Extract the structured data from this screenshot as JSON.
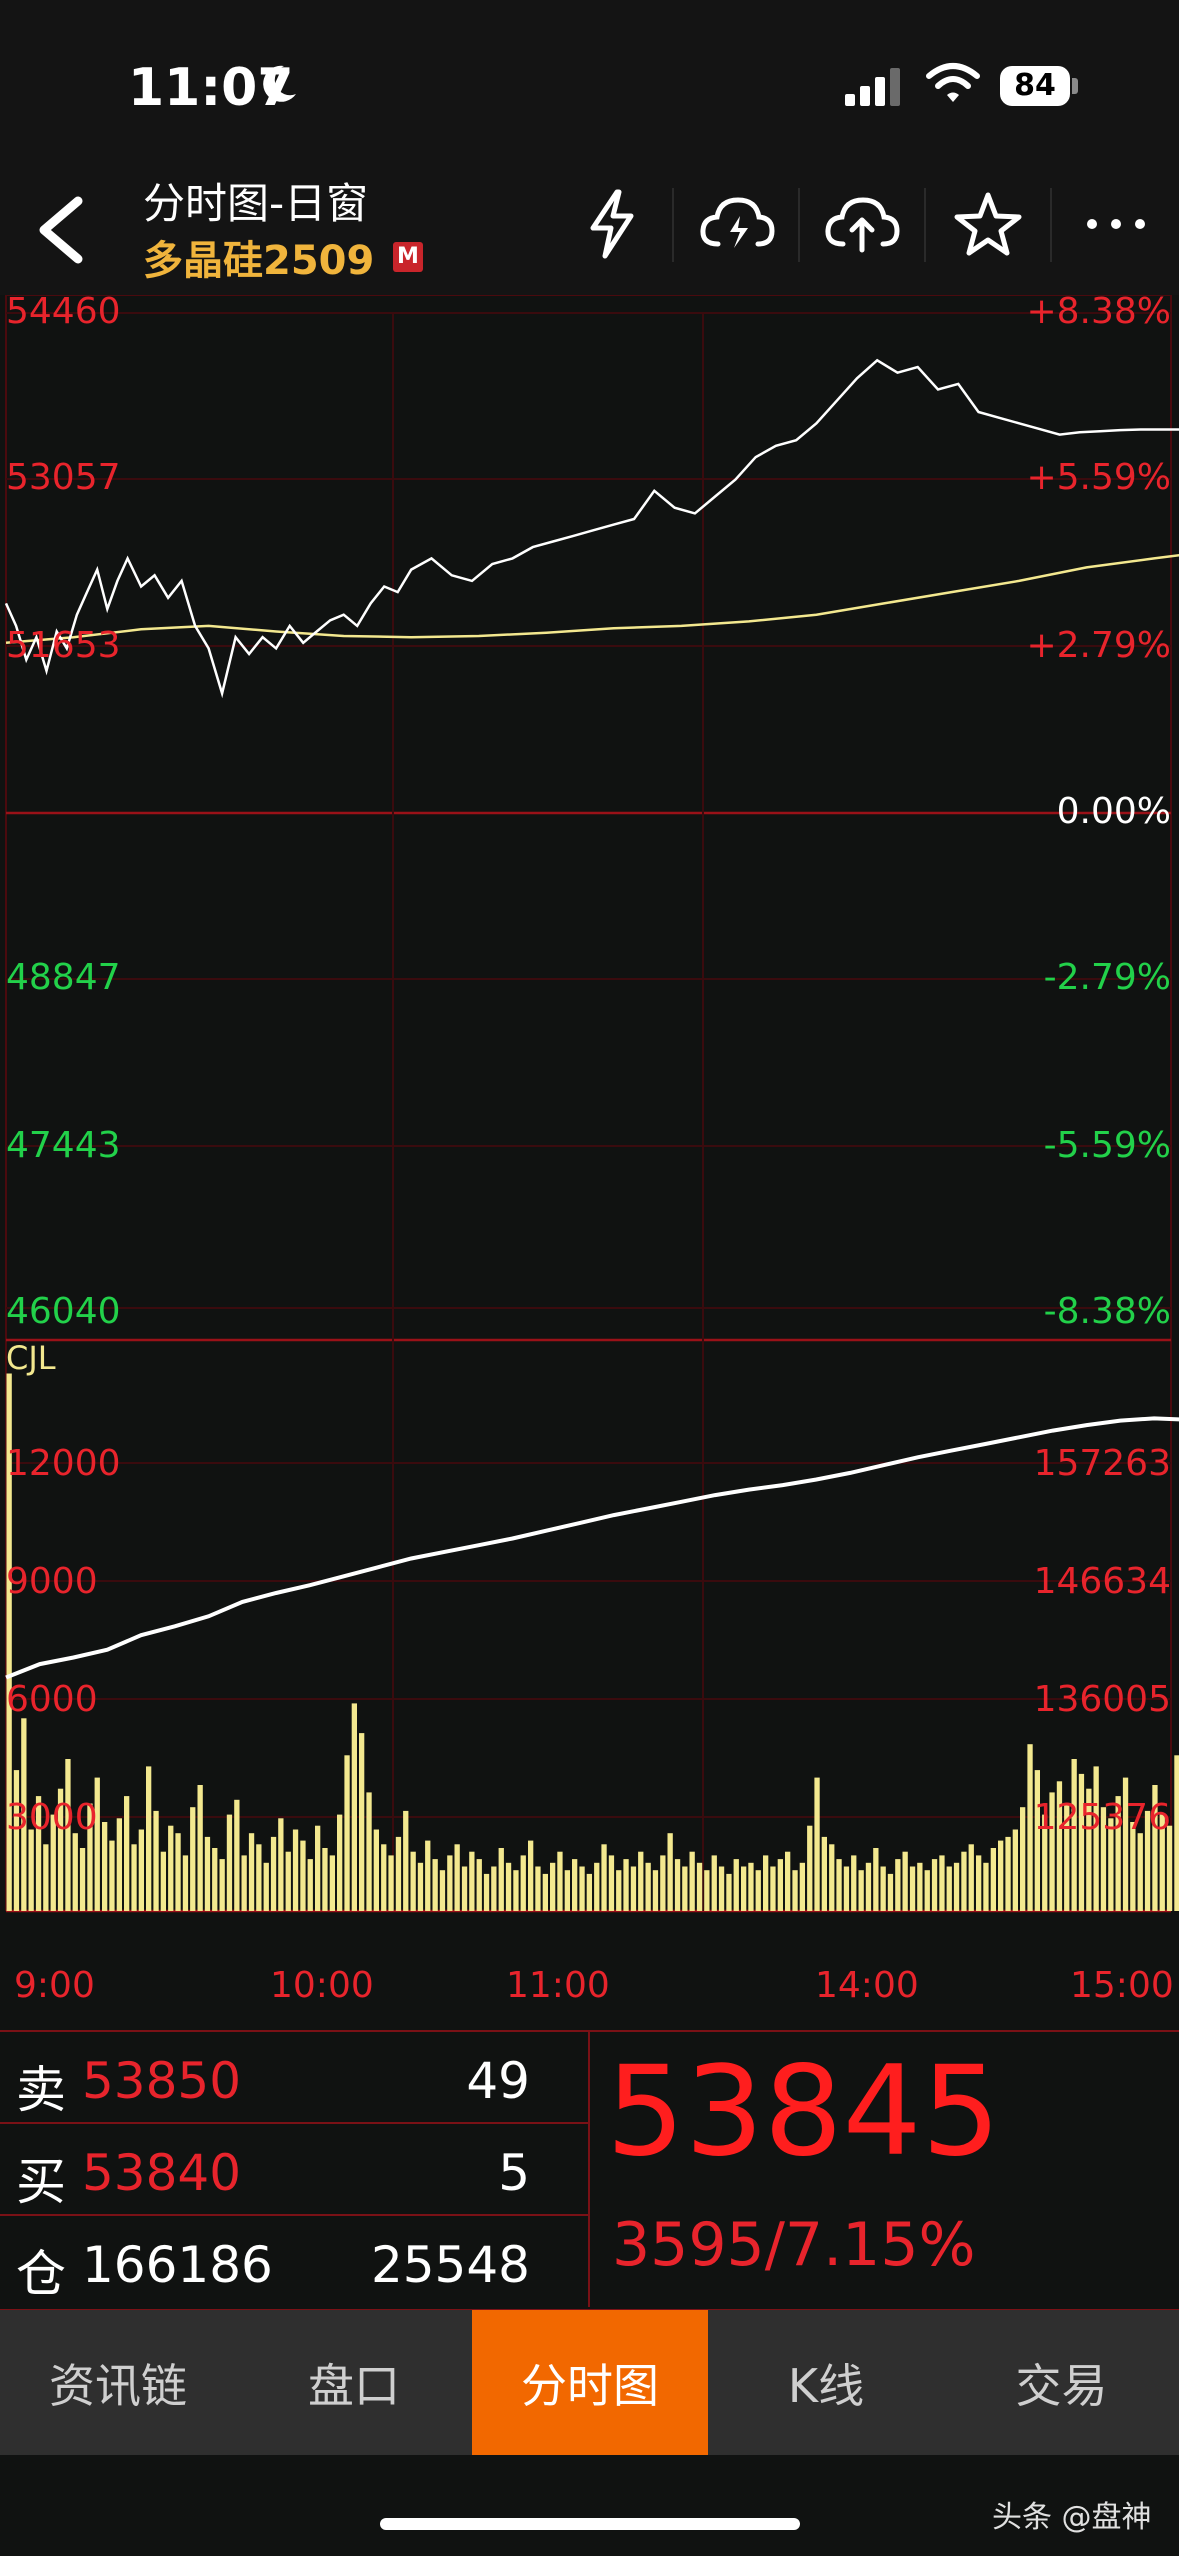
{
  "status_bar": {
    "time": "11:07",
    "battery": "84"
  },
  "header": {
    "title": "分时图-日窗",
    "instrument": "多晶硅2509",
    "badge": "M",
    "tools": [
      "lightning-icon",
      "cloud-lightning-icon",
      "cloud-upload-icon",
      "star-icon",
      "more-icon"
    ]
  },
  "chart": {
    "price_labels_left": [
      "54460",
      "53057",
      "51653",
      "48847",
      "47443",
      "46040"
    ],
    "pct_labels_right": [
      "+8.38%",
      "+5.59%",
      "+2.79%",
      "0.00%",
      "-2.79%",
      "-5.59%",
      "-8.38%"
    ],
    "indicator_name": "CJL",
    "vol_labels_left": [
      "12000",
      "9000",
      "6000",
      "3000"
    ],
    "oi_labels_right": [
      "157263",
      "146634",
      "136005",
      "125376"
    ],
    "time_labels": [
      "9:00",
      "10:00",
      "11:00",
      "14:00",
      "15:00"
    ]
  },
  "chart_data": {
    "type": "line",
    "x_session_minutes": 345,
    "price_line": {
      "t": [
        0,
        3,
        6,
        9,
        12,
        15,
        18,
        21,
        24,
        27,
        30,
        33,
        36,
        40,
        44,
        48,
        52,
        56,
        60,
        64,
        68,
        72,
        76,
        80,
        84,
        88,
        92,
        96,
        100,
        104,
        108,
        112,
        116,
        120,
        126,
        132,
        138,
        144,
        150,
        156,
        162,
        168,
        174,
        180,
        186,
        192,
        198,
        204,
        210,
        216,
        222,
        228,
        234,
        240,
        246,
        252,
        258,
        264,
        270,
        276,
        282,
        288,
        294,
        300,
        306,
        312,
        318,
        324,
        330,
        336,
        342,
        348
      ],
      "v": [
        52300,
        52100,
        51800,
        52000,
        51700,
        52050,
        51900,
        52200,
        52400,
        52600,
        52250,
        52500,
        52700,
        52450,
        52550,
        52350,
        52500,
        52100,
        51900,
        51500,
        52000,
        51850,
        52000,
        51900,
        52100,
        51950,
        52050,
        52150,
        52200,
        52100,
        52300,
        52450,
        52400,
        52600,
        52700,
        52550,
        52500,
        52650,
        52700,
        52800,
        52850,
        52900,
        52950,
        53000,
        53050,
        53300,
        53150,
        53100,
        53250,
        53400,
        53600,
        53700,
        53750,
        53900,
        54100,
        54300,
        54460,
        54350,
        54400,
        54200,
        54250,
        54000,
        53950,
        53900,
        53850,
        53800,
        53820,
        53830,
        53840,
        53845,
        53845,
        53845
      ]
    },
    "avg_line": {
      "t": [
        0,
        20,
        40,
        60,
        80,
        100,
        120,
        140,
        160,
        180,
        200,
        220,
        240,
        260,
        280,
        300,
        320,
        340,
        348
      ],
      "v": [
        51950,
        52000,
        52070,
        52100,
        52050,
        52010,
        52000,
        52010,
        52040,
        52080,
        52100,
        52140,
        52200,
        52300,
        52400,
        52500,
        52620,
        52700,
        52730
      ]
    },
    "open_interest_line": {
      "t": [
        0,
        10,
        20,
        30,
        40,
        50,
        60,
        70,
        80,
        90,
        100,
        110,
        120,
        130,
        140,
        150,
        160,
        170,
        180,
        190,
        200,
        210,
        220,
        230,
        240,
        250,
        260,
        270,
        280,
        290,
        300,
        310,
        320,
        330,
        340,
        348
      ],
      "v": [
        139000,
        140200,
        140800,
        141500,
        142800,
        143600,
        144500,
        145800,
        146600,
        147300,
        148100,
        148900,
        149700,
        150300,
        150900,
        151500,
        152200,
        152900,
        153600,
        154200,
        154800,
        155400,
        155900,
        156300,
        156800,
        157400,
        158100,
        158800,
        159400,
        160000,
        160600,
        161200,
        161700,
        162100,
        162300,
        162200
      ]
    },
    "volume": {
      "ylim": [
        0,
        15000
      ],
      "bars": [
        14500,
        3800,
        5200,
        2200,
        3100,
        1800,
        2600,
        3300,
        4100,
        2100,
        1700,
        2900,
        3600,
        2400,
        1900,
        2500,
        3100,
        1800,
        2200,
        3900,
        2700,
        1600,
        2300,
        2100,
        1500,
        2800,
        3400,
        2000,
        1700,
        1400,
        2600,
        3000,
        1500,
        2100,
        1800,
        1300,
        2000,
        2500,
        1600,
        2200,
        1900,
        1400,
        2300,
        1700,
        1500,
        2600,
        4200,
        5600,
        4800,
        3200,
        2200,
        1800,
        1500,
        2000,
        2700,
        1600,
        1300,
        1900,
        1400,
        1100,
        1500,
        1800,
        1200,
        1600,
        1400,
        1000,
        1200,
        1700,
        1300,
        1100,
        1500,
        1900,
        1200,
        1000,
        1300,
        1600,
        1100,
        1400,
        1200,
        1000,
        1300,
        1800,
        1500,
        1100,
        1400,
        1200,
        1600,
        1300,
        1100,
        1500,
        2100,
        1400,
        1200,
        1600,
        1300,
        1100,
        1500,
        1200,
        1000,
        1400,
        1200,
        1300,
        1100,
        1500,
        1200,
        1400,
        1600,
        1100,
        1300,
        2300,
        3600,
        2000,
        1800,
        1400,
        1200,
        1500,
        1100,
        1300,
        1700,
        1200,
        1000,
        1400,
        1600,
        1200,
        1300,
        1100,
        1400,
        1500,
        1200,
        1300,
        1600,
        1800,
        1500,
        1300,
        1700,
        1900,
        2000,
        2200,
        2800,
        4500,
        3800,
        2600,
        3200,
        3500,
        2900,
        4100,
        3700,
        3300,
        3900,
        2800,
        2500,
        3100,
        3600,
        2400,
        2100,
        2700,
        3400,
        2600,
        2300,
        4200
      ]
    },
    "price_ylim": [
      46040,
      54880
    ],
    "oi_ylim": [
      118000,
      168000
    ]
  },
  "quote": {
    "sell_label": "卖",
    "sell_price": "53850",
    "sell_vol": "49",
    "buy_label": "买",
    "buy_price": "53840",
    "buy_vol": "5",
    "oi_label": "仓",
    "oi_value": "166186",
    "oi_change": "25548",
    "last_price": "53845",
    "change": "3595/7.15%"
  },
  "tabs": [
    "资讯链",
    "盘口",
    "分时图",
    "K线",
    "交易"
  ],
  "active_tab": 2,
  "watermark": "头条 @盘神",
  "colors": {
    "up": "#e8242c",
    "down": "#22d14a",
    "accent": "#f26800",
    "avg_line": "#f3e88f",
    "volume_bar": "#f3e88f"
  }
}
